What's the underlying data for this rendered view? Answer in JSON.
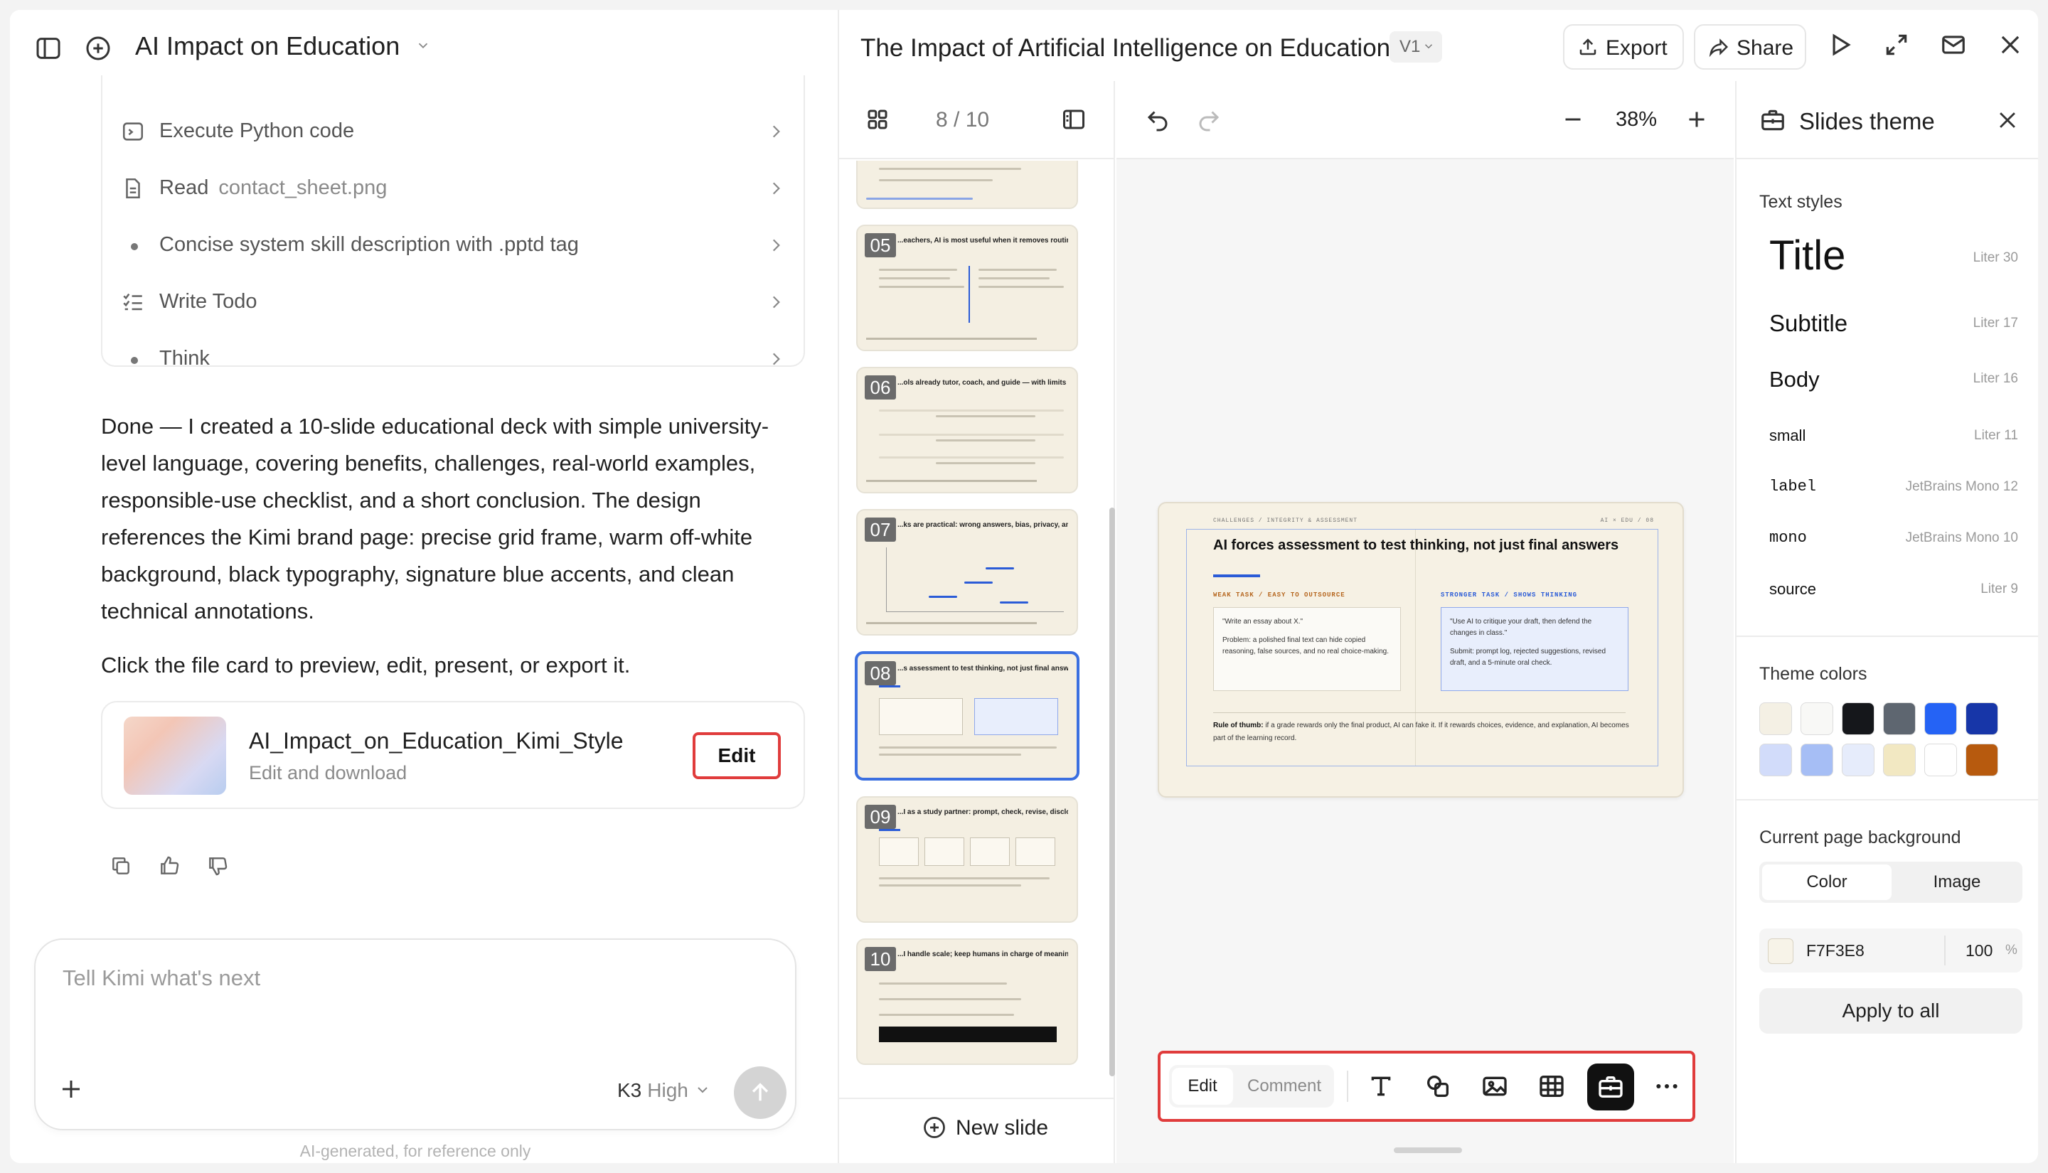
{
  "chat": {
    "title": "AI Impact on Education",
    "steps": [
      {
        "label": "Execute Python code",
        "arg": "",
        "icon": "terminal-icon"
      },
      {
        "label": "Read",
        "arg": "contact_sheet.png",
        "icon": "file-icon"
      },
      {
        "label": "Concise system skill description with .pptd tag",
        "arg": "",
        "icon": "dot"
      },
      {
        "label": "Write Todo",
        "arg": "",
        "icon": "checklist-icon"
      },
      {
        "label": "Think",
        "arg": "",
        "icon": "dot"
      }
    ],
    "message_lines": [
      "Done — I created a 10-slide educational deck with simple university-",
      "level language, covering benefits, challenges, real-world examples,",
      "responsible-use checklist, and a short conclusion. The design",
      "references the Kimi brand page: precise grid frame, warm off-white",
      "background, black typography, signature blue accents, and clean",
      "technical annotations."
    ],
    "message_2": "Click the file card to preview, edit, present, or export it.",
    "file_card": {
      "name": "AI_Impact_on_Education_Kimi_Style",
      "subtitle": "Edit and download",
      "edit_label": "Edit"
    },
    "composer": {
      "placeholder": "Tell Kimi what's next",
      "model": "K3",
      "mode": "High"
    },
    "disclaimer": "AI-generated, for reference only"
  },
  "app": {
    "doc_title": "The Impact of Artificial Intelligence on Education",
    "version": "V1",
    "export_label": "Export",
    "share_label": "Share",
    "page_indicator": "8 / 10",
    "zoom": "38%",
    "new_slide_label": "New slide"
  },
  "thumbs": [
    {
      "num": "05",
      "title": "...eachers, AI is most useful when it removes routine work, not ...ationships."
    },
    {
      "num": "06",
      "title": "...ols already tutor, coach, and guide — with limits"
    },
    {
      "num": "07",
      "title": "...ks are practical: wrong answers, bias, privacy, and"
    },
    {
      "num": "08",
      "title": "...s assessment to test thinking, not just final answers"
    },
    {
      "num": "09",
      "title": "...I as a study partner: prompt, check, revise, disclose"
    },
    {
      "num": "10",
      "title": "...I handle scale; keep humans in charge of meaning"
    }
  ],
  "slide": {
    "eyebrow": "CHALLENGES  /  INTEGRITY & ASSESSMENT",
    "eyebrow_right": "AI × EDU  /  08",
    "title": "AI forces assessment to test thinking, not just final answers",
    "left_label": "WEAK TASK  /  EASY TO OUTSOURCE",
    "left_p1": "\"Write an essay about X.\"",
    "left_p2": "Problem: a polished final text can hide copied reasoning, false sources, and no real choice-making.",
    "right_label": "STRONGER TASK  /  SHOWS THINKING",
    "right_p1": "\"Use AI to critique your draft, then defend the changes in class.\"",
    "right_p2": "Submit: prompt log, rejected suggestions, revised draft, and a 5-minute oral check.",
    "rule_bold": "Rule of thumb:",
    "rule_text": " if a grade rewards only the final product, AI can fake it. If it rewards choices, evidence, and explanation, AI becomes part of the learning record."
  },
  "toolbar": {
    "edit": "Edit",
    "comment": "Comment"
  },
  "theme": {
    "title": "Slides theme",
    "text_styles_label": "Text styles",
    "styles": [
      {
        "name": "Title",
        "meta": "Liter 30"
      },
      {
        "name": "Subtitle",
        "meta": "Liter 17"
      },
      {
        "name": "Body",
        "meta": "Liter 16"
      },
      {
        "name": "small",
        "meta": "Liter 11"
      },
      {
        "name": "label",
        "meta": "JetBrains Mono 12"
      },
      {
        "name": "mono",
        "meta": "JetBrains Mono 10"
      },
      {
        "name": "source",
        "meta": "Liter 9"
      }
    ],
    "colors_label": "Theme colors",
    "colors": [
      "#F4F0E4",
      "#F8F8F6",
      "#15171B",
      "#5E6670",
      "#2563F5",
      "#1736A8",
      "#D2DCFA",
      "#A6BEF5",
      "#E6ECFB",
      "#F2E8C2",
      "#FFFFFF",
      "#B75A0E"
    ],
    "bg_label": "Current page background",
    "bg_color_tab": "Color",
    "bg_image_tab": "Image",
    "bg_hex": "F7F3E8",
    "bg_opacity": "100",
    "bg_pct": "%",
    "apply_label": "Apply to all"
  }
}
